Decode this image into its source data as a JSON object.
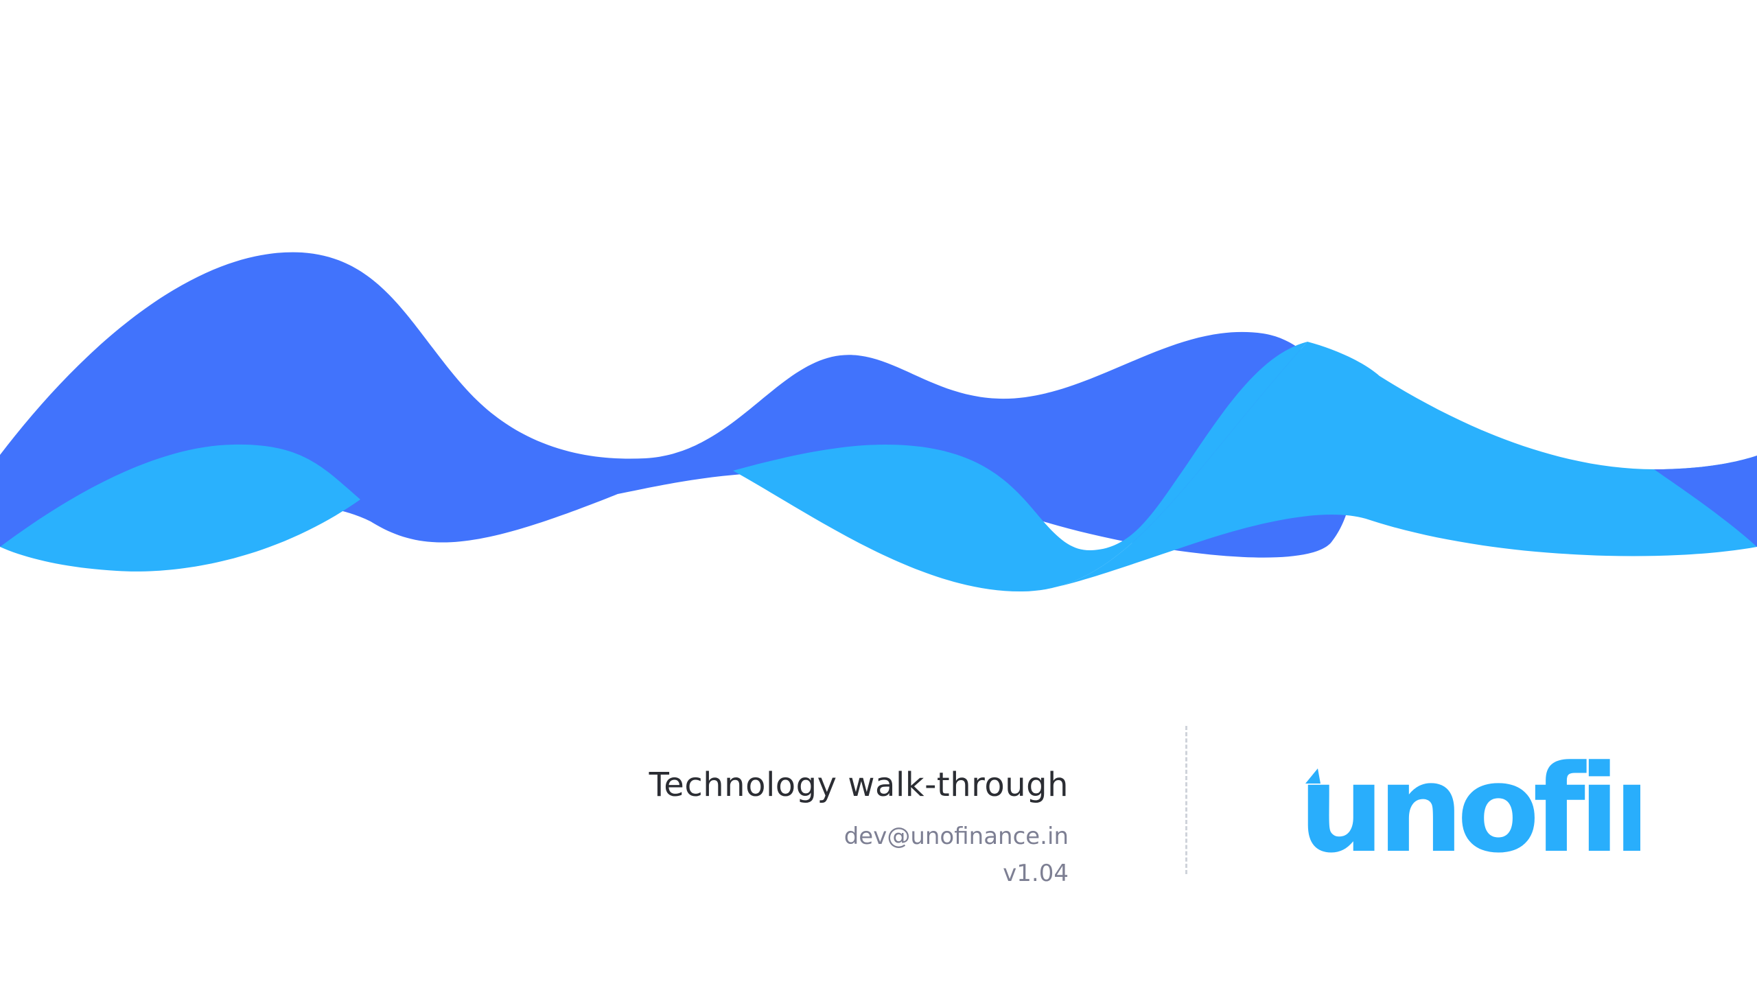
{
  "slide": {
    "title": "Technology walk-through",
    "email": "dev@unofinance.in",
    "version": "v1.04"
  },
  "logo": {
    "text": "unofin"
  },
  "colors": {
    "wave_dark": "#4173fc",
    "wave_light": "#2ab1fd",
    "logo": "#29aefc",
    "title": "#2b2d33",
    "subtext": "#7d7f93",
    "divider": "#cfd3da",
    "background": "#ffffff"
  }
}
